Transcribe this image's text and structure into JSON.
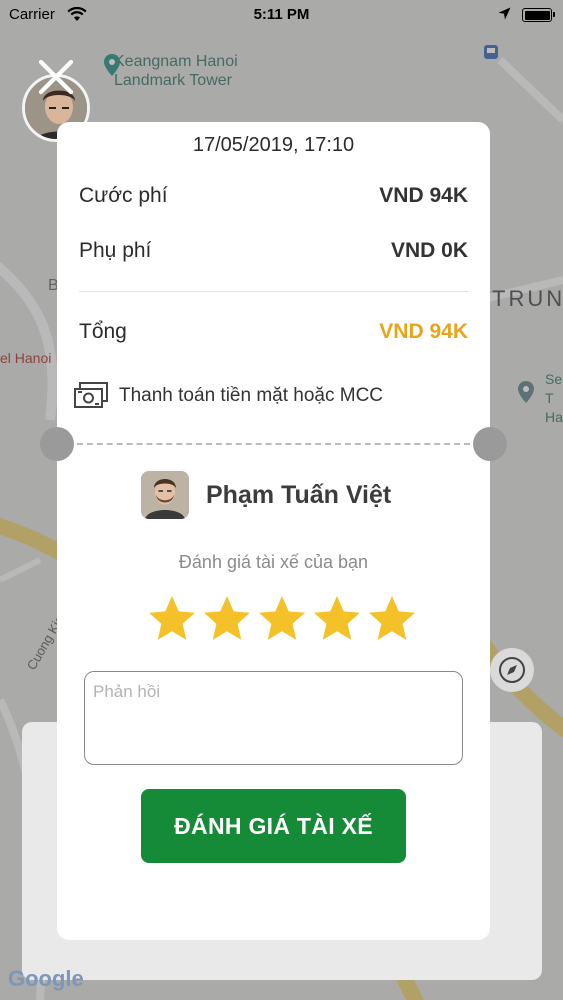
{
  "status_bar": {
    "carrier": "Carrier",
    "time": "5:11 PM"
  },
  "map": {
    "labels": {
      "landmark": "Keangnam Hanoi\nLandmark Tower",
      "trung": "TRUNG",
      "hanoi_fragment": "el Hanoi",
      "street_1": "Cuong Kien",
      "right_fragment": "Se\nT\nHa",
      "left_letter": "B",
      "google": "Google"
    }
  },
  "receipt": {
    "datetime": "17/05/2019, 17:10",
    "fare_label": "Cước phí",
    "fare_value": "VND 94K",
    "surcharge_label": "Phụ phí",
    "surcharge_value": "VND 0K",
    "total_label": "Tổng",
    "total_value": "VND 94K",
    "payment_method": "Thanh toán tiền mặt hoặc MCC"
  },
  "driver": {
    "name": "Phạm Tuấn Việt"
  },
  "rating": {
    "prompt": "Đánh giá tài xế của bạn",
    "stars_total": 5,
    "stars_selected": 5,
    "feedback_placeholder": "Phản hồi",
    "feedback_value": "",
    "submit_label": "ĐÁNH GIÁ TÀI XẾ"
  },
  "colors": {
    "accent_total": "#eaa41a",
    "button_green": "#158a37",
    "star_yellow": "#f4c228"
  }
}
